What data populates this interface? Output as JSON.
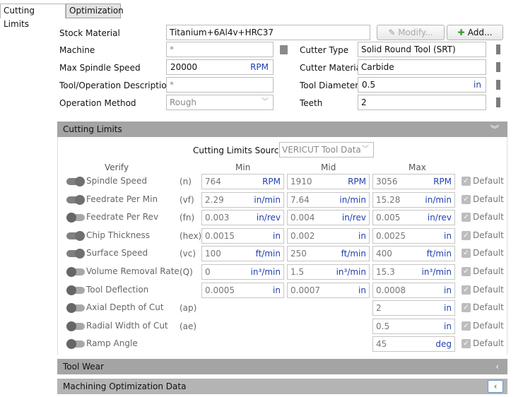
{
  "tabs": [
    {
      "label": "Cutting Limits"
    },
    {
      "label": "Optimization"
    }
  ],
  "stock": {
    "label": "Stock Material",
    "value": "Titanium+6Al4v+HRC37",
    "modify_label": "Modify...",
    "add_label": "Add..."
  },
  "machine": {
    "label": "Machine",
    "value": "*"
  },
  "spindle": {
    "label": "Max Spindle Speed",
    "value": "20000",
    "unit": "RPM"
  },
  "tool_desc": {
    "label": "Tool/Operation Description",
    "value": "*"
  },
  "op_method": {
    "label": "Operation Method",
    "value": "Rough"
  },
  "cutter_type": {
    "label": "Cutter Type",
    "value": "Solid Round Tool (SRT)"
  },
  "cutter_material": {
    "label": "Cutter Material",
    "value": "Carbide"
  },
  "tool_diameter": {
    "label": "Tool Diameter",
    "value": "0.5",
    "unit": "in"
  },
  "teeth": {
    "label": "Teeth",
    "value": "2"
  },
  "panels": {
    "cutting_limits": "Cutting Limits",
    "tool_wear": "Tool Wear",
    "mach_opt": "Machining Optimization Data"
  },
  "source": {
    "label": "Cutting Limits Source",
    "value": "VERICUT Tool Data"
  },
  "columns": {
    "verify": "Verify",
    "min": "Min",
    "mid": "Mid",
    "max": "Max"
  },
  "default_label": "Default",
  "rows": [
    {
      "label": "Spindle Speed",
      "abbr": "(n)",
      "min": "764",
      "min_u": "RPM",
      "mid": "1910",
      "mid_u": "RPM",
      "max": "3056",
      "max_u": "RPM"
    },
    {
      "label": "Feedrate Per Min",
      "abbr": "(vf)",
      "min": "2.29",
      "min_u": "in/min",
      "mid": "7.64",
      "mid_u": "in/min",
      "max": "15.28",
      "max_u": "in/min"
    },
    {
      "label": "Feedrate Per Rev",
      "abbr": "(fn)",
      "min": "0.003",
      "min_u": "in/rev",
      "mid": "0.004",
      "mid_u": "in/rev",
      "max": "0.005",
      "max_u": "in/rev"
    },
    {
      "label": "Chip Thickness",
      "abbr": "(hex)",
      "min": "0.0015",
      "min_u": "in",
      "mid": "0.002",
      "mid_u": "in",
      "max": "0.0025",
      "max_u": "in"
    },
    {
      "label": "Surface Speed",
      "abbr": "(vc)",
      "min": "100",
      "min_u": "ft/min",
      "mid": "250",
      "mid_u": "ft/min",
      "max": "400",
      "max_u": "ft/min"
    },
    {
      "label": "Volume Removal Rate",
      "abbr": "(Q)",
      "min": "0",
      "min_u": "in³/min",
      "mid": "1.5",
      "mid_u": "in³/min",
      "max": "15.3",
      "max_u": "in³/min"
    },
    {
      "label": "Tool Deflection",
      "abbr": "",
      "min": "0.0005",
      "min_u": "in",
      "mid": "0.0007",
      "mid_u": "in",
      "max": "0.0008",
      "max_u": "in"
    },
    {
      "label": "Axial Depth of Cut",
      "abbr": "(ap)",
      "max": "2",
      "max_u": "in"
    },
    {
      "label": "Radial Width of Cut",
      "abbr": "(ae)",
      "max": "0.5",
      "max_u": "in"
    },
    {
      "label": "Ramp Angle",
      "abbr": "",
      "max": "45",
      "max_u": "deg"
    }
  ]
}
